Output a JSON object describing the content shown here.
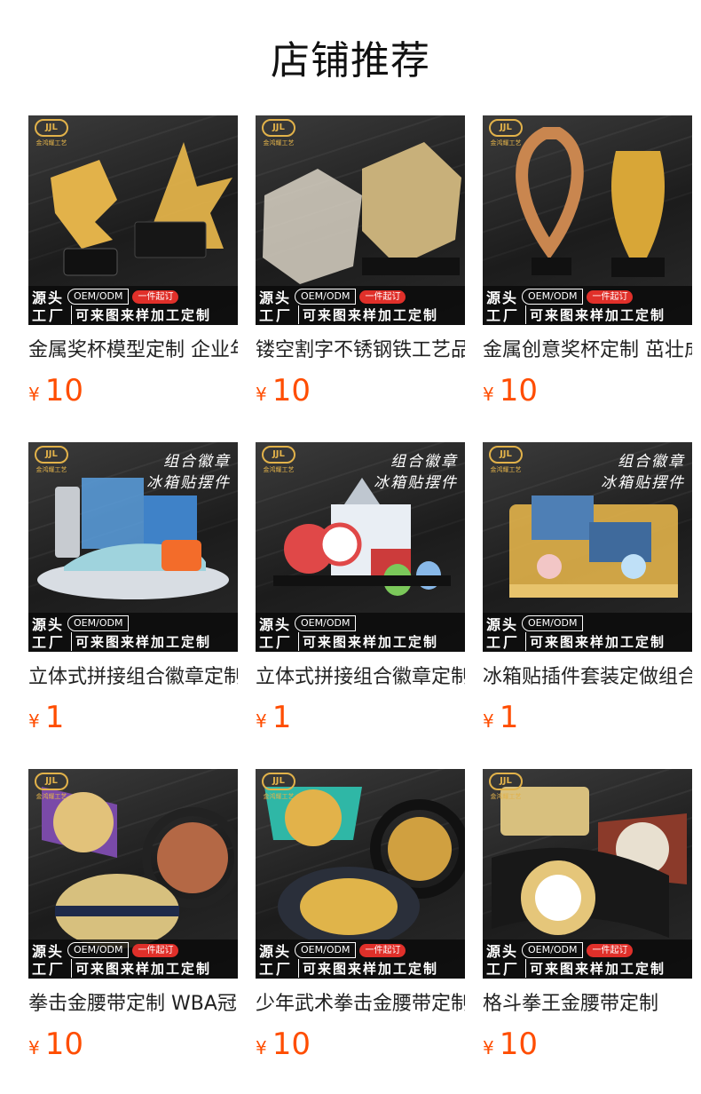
{
  "page": {
    "title": "店铺推荐"
  },
  "badge": {
    "logo_text": "JJL",
    "logo_sub": "金鸿耀工艺",
    "source": "源头",
    "factory": "工厂",
    "oem": "OEM/ODM",
    "min_order": "一件起订",
    "custom": "可来图来样加工定制",
    "combo_line1": "组合徽章",
    "combo_line2": "冰箱贴摆件"
  },
  "products": [
    {
      "name": "金属奖杯模型定制 企业年会颁奖",
      "currency": "¥",
      "price": "10",
      "min_tag": true,
      "banner": false,
      "art": "trophy-star",
      "accent": "#e2b24a"
    },
    {
      "name": "镂空割字不锈钢铁工艺品摆件",
      "currency": "¥",
      "price": "10",
      "min_tag": true,
      "banner": false,
      "art": "cube",
      "accent": "#d9d2c4"
    },
    {
      "name": "金属创意奖杯定制 茁壮成长",
      "currency": "¥",
      "price": "10",
      "min_tag": true,
      "banner": false,
      "art": "trophy-swirl",
      "accent": "#c9864f"
    },
    {
      "name": "立体式拼接组合徽章定制",
      "currency": "¥",
      "price": "1",
      "min_tag": false,
      "banner": true,
      "art": "city-car",
      "accent": "#5aa0e0"
    },
    {
      "name": "立体式拼接组合徽章定制",
      "currency": "¥",
      "price": "1",
      "min_tag": false,
      "banner": true,
      "art": "city-building",
      "accent": "#e04848"
    },
    {
      "name": "冰箱贴插件套装定做组合",
      "currency": "¥",
      "price": "1",
      "min_tag": false,
      "banner": true,
      "art": "city-gold",
      "accent": "#e2b24a"
    },
    {
      "name": "拳击金腰带定制 WBA冠军",
      "currency": "¥",
      "price": "10",
      "min_tag": true,
      "banner": false,
      "art": "belt-purple",
      "accent": "#7a4aa8"
    },
    {
      "name": "少年武术拳击金腰带定制",
      "currency": "¥",
      "price": "10",
      "min_tag": true,
      "banner": false,
      "art": "belt-teal",
      "accent": "#2fb7a6"
    },
    {
      "name": "格斗拳王金腰带定制",
      "currency": "¥",
      "price": "10",
      "min_tag": true,
      "banner": false,
      "art": "belt-dark",
      "accent": "#8b3a2a"
    }
  ]
}
